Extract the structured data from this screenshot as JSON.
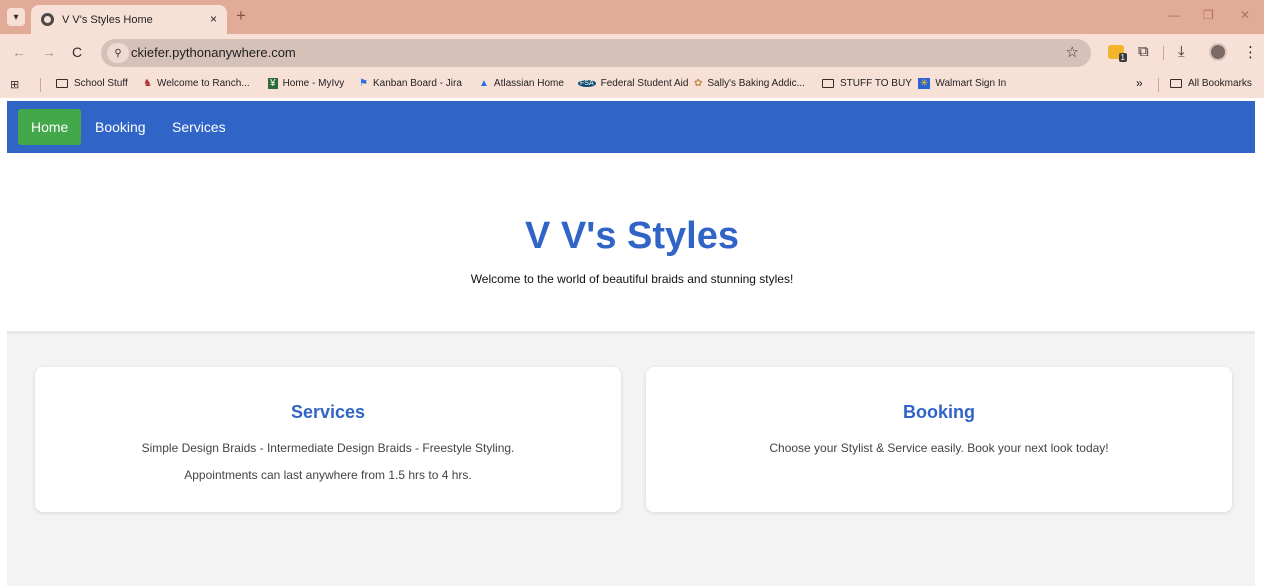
{
  "browser": {
    "tab_title": "V V's Styles Home",
    "tab_close": "×",
    "new_tab": "+",
    "url": "ckiefer.pythonanywhere.com",
    "extension_badge": "1"
  },
  "bookmarks": {
    "items": [
      {
        "label": "School Stuff",
        "icon": "folder-icon"
      },
      {
        "label": "Welcome to Ranch...",
        "icon": "ranch-icon"
      },
      {
        "label": "Home - MyIvy",
        "icon": "ivy-icon"
      },
      {
        "label": "Kanban Board - Jira",
        "icon": "jira-icon"
      },
      {
        "label": "Atlassian Home",
        "icon": "atlassian-icon"
      },
      {
        "label": "Federal Student Aid",
        "icon": "fsa-icon"
      },
      {
        "label": "Sally's Baking Addic...",
        "icon": "sally-icon"
      },
      {
        "label": "STUFF TO BUY",
        "icon": "folder-icon"
      },
      {
        "label": "Walmart Sign In",
        "icon": "walmart-icon"
      }
    ],
    "overflow": "»",
    "all_bookmarks": "All Bookmarks"
  },
  "site": {
    "nav": [
      "Home",
      "Booking",
      "Services"
    ],
    "title": "V V's Styles",
    "tagline": "Welcome to the world of beautiful braids and stunning styles!",
    "services_card": {
      "heading": "Services",
      "line1": "Simple Design Braids - Intermediate Design Braids - Freestyle Styling.",
      "line2": "Appointments can last anywhere from 1.5 hrs to 4 hrs."
    },
    "booking_card": {
      "heading": "Booking",
      "line1": "Choose your Stylist & Service easily. Book your next look today!"
    }
  },
  "colors": {
    "brand_blue": "#3164c7",
    "active_green": "#43a84a",
    "chrome_frame": "#e2ab97",
    "chrome_toolbar": "#f7e1d7"
  }
}
